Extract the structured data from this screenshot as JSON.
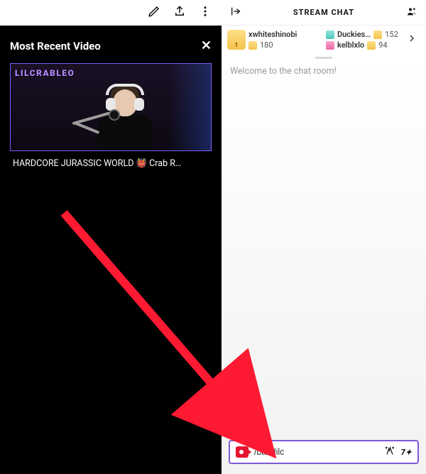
{
  "left": {
    "panel_title": "Most Recent Video",
    "thumb_badge": "LILCRABLEO",
    "video_title": "HARDCORE JURASSIC WORLD 👹 Crab R…"
  },
  "chat": {
    "header_title": "STREAM CHAT",
    "welcome": "Welcome to the chat room!",
    "gifters": {
      "top": {
        "name": "xwhiteshinobi",
        "count": "180"
      },
      "second": {
        "name": "Duckies…",
        "count": "152"
      },
      "third": {
        "name": "kelblxlo",
        "count": "94"
      }
    },
    "input_value": "/ban lilc",
    "bits_label": "7✦"
  }
}
